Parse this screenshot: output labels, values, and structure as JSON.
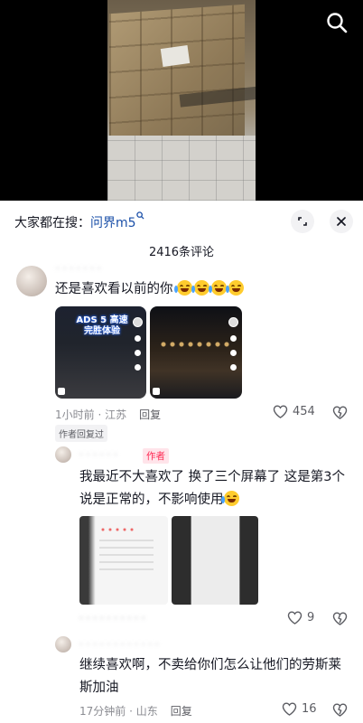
{
  "search": {
    "prefix": "大家都在搜：",
    "keyword": "问界m5"
  },
  "comments_count": "2416条评论",
  "comments": [
    {
      "text": "还是喜欢看以前的你",
      "emoji_count": 4,
      "thumb_title": "ADS 5 高速完胜体验",
      "meta_time": "1小时前 · 江苏",
      "reply_label": "回复",
      "likes": "454",
      "badge": "作者回复过"
    },
    {
      "author_tag": "作者",
      "text": "我最近不大喜欢了   换了三个屏幕了  这是第3个   说是正常的，不影响使用",
      "likes": "9"
    },
    {
      "text": "继续喜欢啊，不卖给你们怎么让他们的劳斯莱斯加油",
      "meta_time": "17分钟前 · 山东",
      "reply_label": "回复",
      "likes": "16"
    }
  ],
  "icons": {
    "search": "search-icon",
    "expand": "expand-icon",
    "close": "close-icon",
    "like": "heart-icon",
    "dislike": "broken-heart-icon"
  }
}
